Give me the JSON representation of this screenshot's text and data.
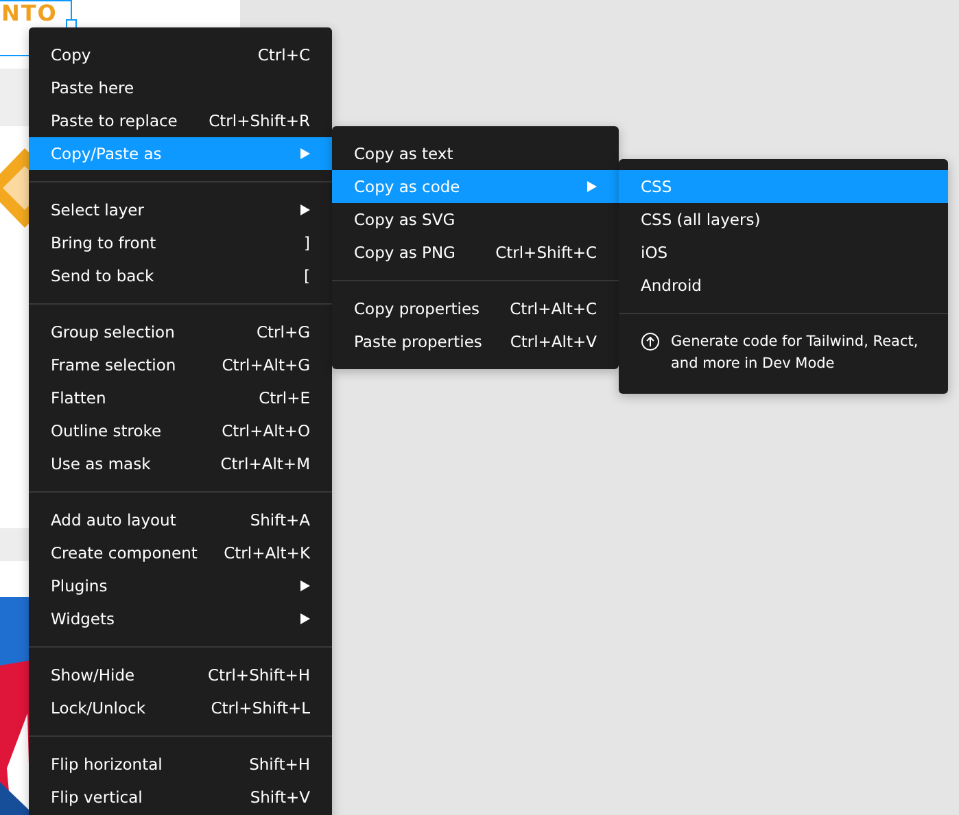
{
  "canvas": {
    "text": "NTO"
  },
  "menus": [
    {
      "items": [
        {
          "kind": "item",
          "label": "Copy",
          "shortcut": "Ctrl+C",
          "selected": false
        },
        {
          "kind": "item",
          "label": "Paste here",
          "selected": false
        },
        {
          "kind": "item",
          "label": "Paste to replace",
          "shortcut": "Ctrl+Shift+R",
          "selected": false
        },
        {
          "kind": "submenu",
          "label": "Copy/Paste as",
          "selected": true
        },
        {
          "kind": "separator"
        },
        {
          "kind": "submenu",
          "label": "Select layer",
          "selected": false
        },
        {
          "kind": "item",
          "label": "Bring to front",
          "shortcut": "]",
          "selected": false
        },
        {
          "kind": "item",
          "label": "Send to back",
          "shortcut": "[",
          "selected": false
        },
        {
          "kind": "separator"
        },
        {
          "kind": "item",
          "label": "Group selection",
          "shortcut": "Ctrl+G",
          "selected": false
        },
        {
          "kind": "item",
          "label": "Frame selection",
          "shortcut": "Ctrl+Alt+G",
          "selected": false
        },
        {
          "kind": "item",
          "label": "Flatten",
          "shortcut": "Ctrl+E",
          "selected": false
        },
        {
          "kind": "item",
          "label": "Outline stroke",
          "shortcut": "Ctrl+Alt+O",
          "selected": false
        },
        {
          "kind": "item",
          "label": "Use as mask",
          "shortcut": "Ctrl+Alt+M",
          "selected": false
        },
        {
          "kind": "separator"
        },
        {
          "kind": "item",
          "label": "Add auto layout",
          "shortcut": "Shift+A",
          "selected": false
        },
        {
          "kind": "item",
          "label": "Create component",
          "shortcut": "Ctrl+Alt+K",
          "selected": false
        },
        {
          "kind": "submenu",
          "label": "Plugins",
          "selected": false
        },
        {
          "kind": "submenu",
          "label": "Widgets",
          "selected": false
        },
        {
          "kind": "separator"
        },
        {
          "kind": "item",
          "label": "Show/Hide",
          "shortcut": "Ctrl+Shift+H",
          "selected": false
        },
        {
          "kind": "item",
          "label": "Lock/Unlock",
          "shortcut": "Ctrl+Shift+L",
          "selected": false
        },
        {
          "kind": "separator"
        },
        {
          "kind": "item",
          "label": "Flip horizontal",
          "shortcut": "Shift+H",
          "selected": false
        },
        {
          "kind": "item",
          "label": "Flip vertical",
          "shortcut": "Shift+V",
          "selected": false
        }
      ]
    },
    {
      "items": [
        {
          "kind": "item",
          "label": "Copy as text",
          "selected": false
        },
        {
          "kind": "submenu",
          "label": "Copy as code",
          "selected": true
        },
        {
          "kind": "item",
          "label": "Copy as SVG",
          "selected": false
        },
        {
          "kind": "item",
          "label": "Copy as PNG",
          "shortcut": "Ctrl+Shift+C",
          "selected": false
        },
        {
          "kind": "separator"
        },
        {
          "kind": "item",
          "label": "Copy properties",
          "shortcut": "Ctrl+Alt+C",
          "selected": false
        },
        {
          "kind": "item",
          "label": "Paste properties",
          "shortcut": "Ctrl+Alt+V",
          "selected": false
        }
      ]
    },
    {
      "items": [
        {
          "kind": "item",
          "label": "CSS",
          "selected": true
        },
        {
          "kind": "item",
          "label": "CSS (all layers)",
          "selected": false
        },
        {
          "kind": "item",
          "label": "iOS",
          "selected": false
        },
        {
          "kind": "item",
          "label": "Android",
          "selected": false
        },
        {
          "kind": "separator"
        },
        {
          "kind": "note",
          "label": "Generate code for Tailwind, React, and more in Dev Mode"
        }
      ]
    }
  ]
}
